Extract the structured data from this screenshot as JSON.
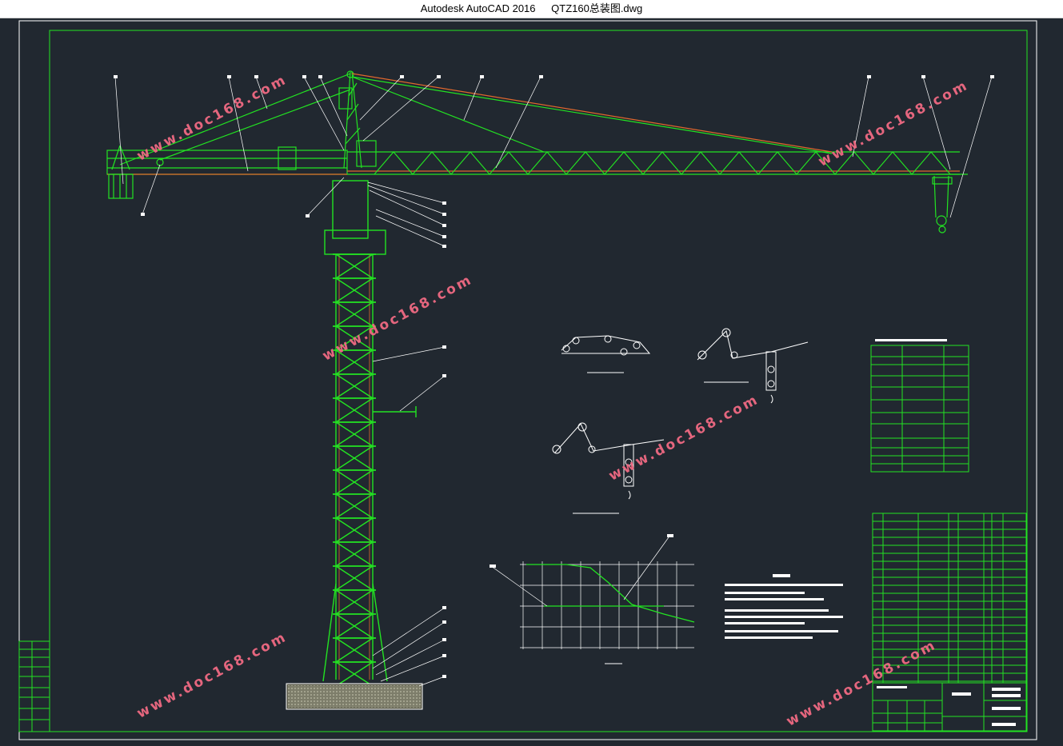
{
  "window": {
    "app_name": "Autodesk AutoCAD 2016",
    "file_name": "QTZ160总装图.dwg"
  },
  "watermark": {
    "text": "www.doc168.com",
    "color": "#f06a83"
  },
  "colors": {
    "background": "#212830",
    "drawing": "#22e322",
    "frame": "#ffffff",
    "accent": "#e0682d"
  },
  "drawing_components": [
    "border-frame",
    "tower-mast",
    "jib",
    "counter-jib",
    "cathead",
    "hook-block",
    "foundation",
    "reeving-diagrams",
    "load-curve-chart",
    "technical-notes",
    "performance-table",
    "parts-list",
    "title-block",
    "revision-block"
  ]
}
